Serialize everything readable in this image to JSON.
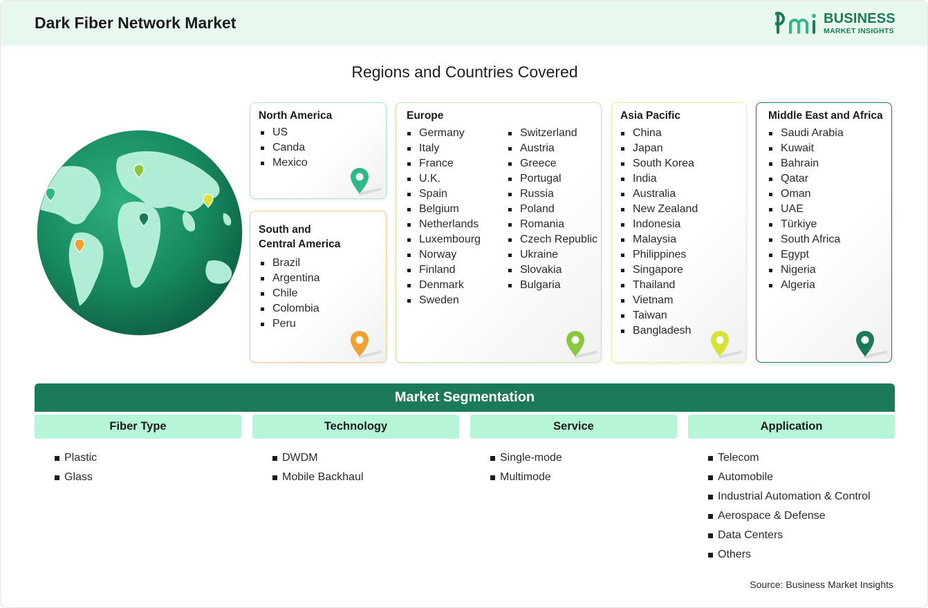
{
  "header": {
    "title": "Dark Fiber Network Market",
    "logo_name": "BUSINESS",
    "logo_sub": "MARKET INSIGHTS"
  },
  "regions_title": "Regions and Countries Covered",
  "regions": {
    "north_america": {
      "title": "North America",
      "items": [
        "US",
        "Canda",
        "Mexico"
      ]
    },
    "south_america": {
      "title_line1": "South and",
      "title_line2": "Central America",
      "items": [
        "Brazil",
        "Argentina",
        "Chile",
        "Colombia",
        "Peru"
      ]
    },
    "europe": {
      "title": "Europe",
      "col1": [
        "Germany",
        "Italy",
        "France",
        "U.K.",
        "Spain",
        "Belgium",
        "Netherlands",
        "Luxembourg",
        "Norway",
        "Finland",
        "Denmark",
        "Sweden"
      ],
      "col2": [
        "Switzerland",
        "Austria",
        "Greece",
        "Portugal",
        "Russia",
        "Poland",
        "Romania",
        "Czech Republic",
        "Ukraine",
        "Slovakia",
        "Bulgaria"
      ]
    },
    "asia_pacific": {
      "title": "Asia Pacific",
      "items": [
        "China",
        "Japan",
        "South Korea",
        "India",
        "Australia",
        "New Zealand",
        "Indonesia",
        "Malaysia",
        "Philippines",
        "Singapore",
        "Thailand",
        "Vietnam",
        "Taiwan",
        "Bangladesh"
      ]
    },
    "mea": {
      "title": "Middle East and Africa",
      "items": [
        "Saudi Arabia",
        "Kuwait",
        "Bahrain",
        "Qatar",
        "Oman",
        "UAE",
        "Türkiye",
        "South Africa",
        "Egypt",
        "Nigeria",
        "Algeria"
      ]
    }
  },
  "colors": {
    "brand": "#1b7a58",
    "north_america": "#2fb888",
    "south_america": "#f0a030",
    "europe": "#8cc63f",
    "asia_pacific": "#d7e335",
    "mea": "#1b7a58"
  },
  "segmentation": {
    "title": "Market Segmentation",
    "columns": [
      {
        "header": "Fiber Type",
        "items": [
          "Plastic",
          "Glass"
        ]
      },
      {
        "header": "Technology",
        "items": [
          "DWDM",
          "Mobile Backhaul"
        ]
      },
      {
        "header": "Service",
        "items": [
          "Single-mode",
          "Multimode"
        ]
      },
      {
        "header": "Application",
        "items": [
          "Telecom",
          "Automobile",
          "Industrial Automation & Control",
          "Aerospace & Defense",
          "Data Centers",
          "Others"
        ]
      }
    ]
  },
  "source": "Source: Business Market Insights"
}
